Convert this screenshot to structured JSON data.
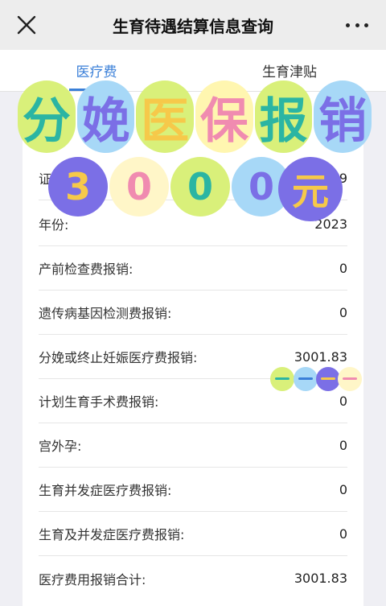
{
  "header": {
    "title": "生育待遇结算信息查询"
  },
  "tabs": [
    {
      "label": "医疗费",
      "active": true
    },
    {
      "label": "生育津贴",
      "active": false
    }
  ],
  "rows": [
    {
      "label": "证",
      "value": "9"
    },
    {
      "label": "年份:",
      "value": "2023"
    },
    {
      "label": "产前检查费报销:",
      "value": "0"
    },
    {
      "label": "遗传病基因检测费报销:",
      "value": "0"
    },
    {
      "label": "分娩或终止妊娠医疗费报销:",
      "value": "3001.83"
    },
    {
      "label": "计划生育手术费报销:",
      "value": "0"
    },
    {
      "label": "宫外孕:",
      "value": "0"
    },
    {
      "label": "生育并发症医疗费报销:",
      "value": "0"
    },
    {
      "label": "生育及并发症医疗费报销:",
      "value": "0"
    },
    {
      "label": "医疗费用报销合计:",
      "value": "3001.83"
    }
  ],
  "overlay": {
    "headline": [
      "分",
      "娩",
      "医",
      "保",
      "报",
      "销"
    ],
    "amount": [
      "3",
      "0",
      "0",
      "0",
      "元"
    ],
    "colors": {
      "teal": "#2bb5a3",
      "purple": "#7b6fe6",
      "yellow": "#f6c94a",
      "pink": "#f08bb0",
      "lime": "#d9f07a",
      "sky": "#a7d8f7"
    }
  },
  "colors": {
    "accent": "#3a7fd8",
    "background": "#efeff4"
  }
}
